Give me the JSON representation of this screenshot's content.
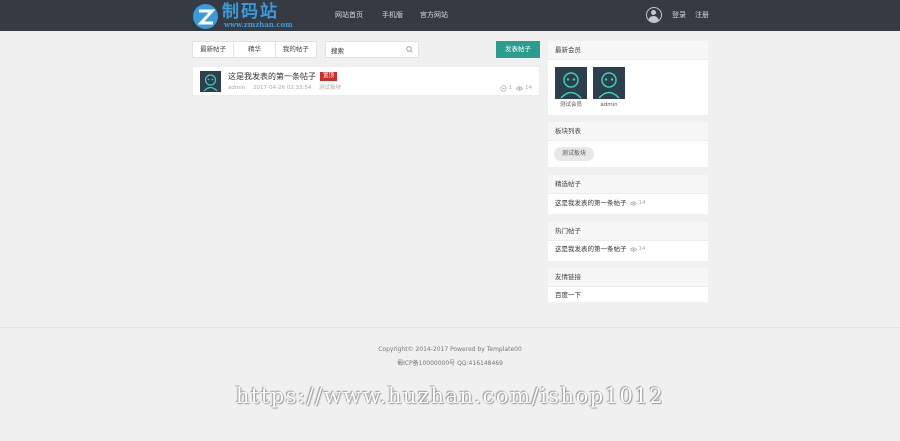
{
  "brand": {
    "name": "制码站",
    "url": "www.zmzhan.com"
  },
  "nav": [
    {
      "label": "网站首页"
    },
    {
      "label": "手机版"
    },
    {
      "label": "官方网站"
    }
  ],
  "user_menu": {
    "login": "登录",
    "register": "注册"
  },
  "filters": [
    {
      "label": "最新帖子"
    },
    {
      "label": "精华"
    },
    {
      "label": "我的帖子"
    }
  ],
  "search": {
    "value": "搜索"
  },
  "post_button": "发表帖子",
  "post": {
    "title": "这是我发表的第一条帖子",
    "badge": "置顶",
    "author": "admin",
    "time": "2017-04-26 02:33:54",
    "board": "测试板块",
    "comments": "1",
    "views": "14"
  },
  "sidebar": {
    "members": {
      "title": "最新会员",
      "items": [
        {
          "name": "测试会员"
        },
        {
          "name": "admin"
        }
      ]
    },
    "boards": {
      "title": "板块列表",
      "items": [
        {
          "label": "测试板块"
        }
      ]
    },
    "featured": {
      "title": "精选帖子",
      "items": [
        {
          "label": "这是我发表的第一条帖子",
          "views": "14"
        }
      ]
    },
    "hot": {
      "title": "热门帖子",
      "items": [
        {
          "label": "这是我发表的第一条帖子",
          "views": "14"
        }
      ]
    },
    "links": {
      "title": "友情链接",
      "items": [
        {
          "label": "百度一下"
        }
      ]
    }
  },
  "footer": {
    "copyright": "Copyright© 2014-2017  Powered by Template00",
    "icp": "蜀ICP备10000000号    QQ:416148469"
  },
  "watermark": "https://www.huzhan.com/ishop1012",
  "colors": {
    "topbar": "#353a43",
    "accent": "#2a9d8f",
    "badge": "#c9302c",
    "brand": "#3a9bdc"
  },
  "icons": [
    "logo-mark",
    "user-icon",
    "search-icon",
    "comment-icon",
    "eye-icon",
    "avatar-robot"
  ]
}
